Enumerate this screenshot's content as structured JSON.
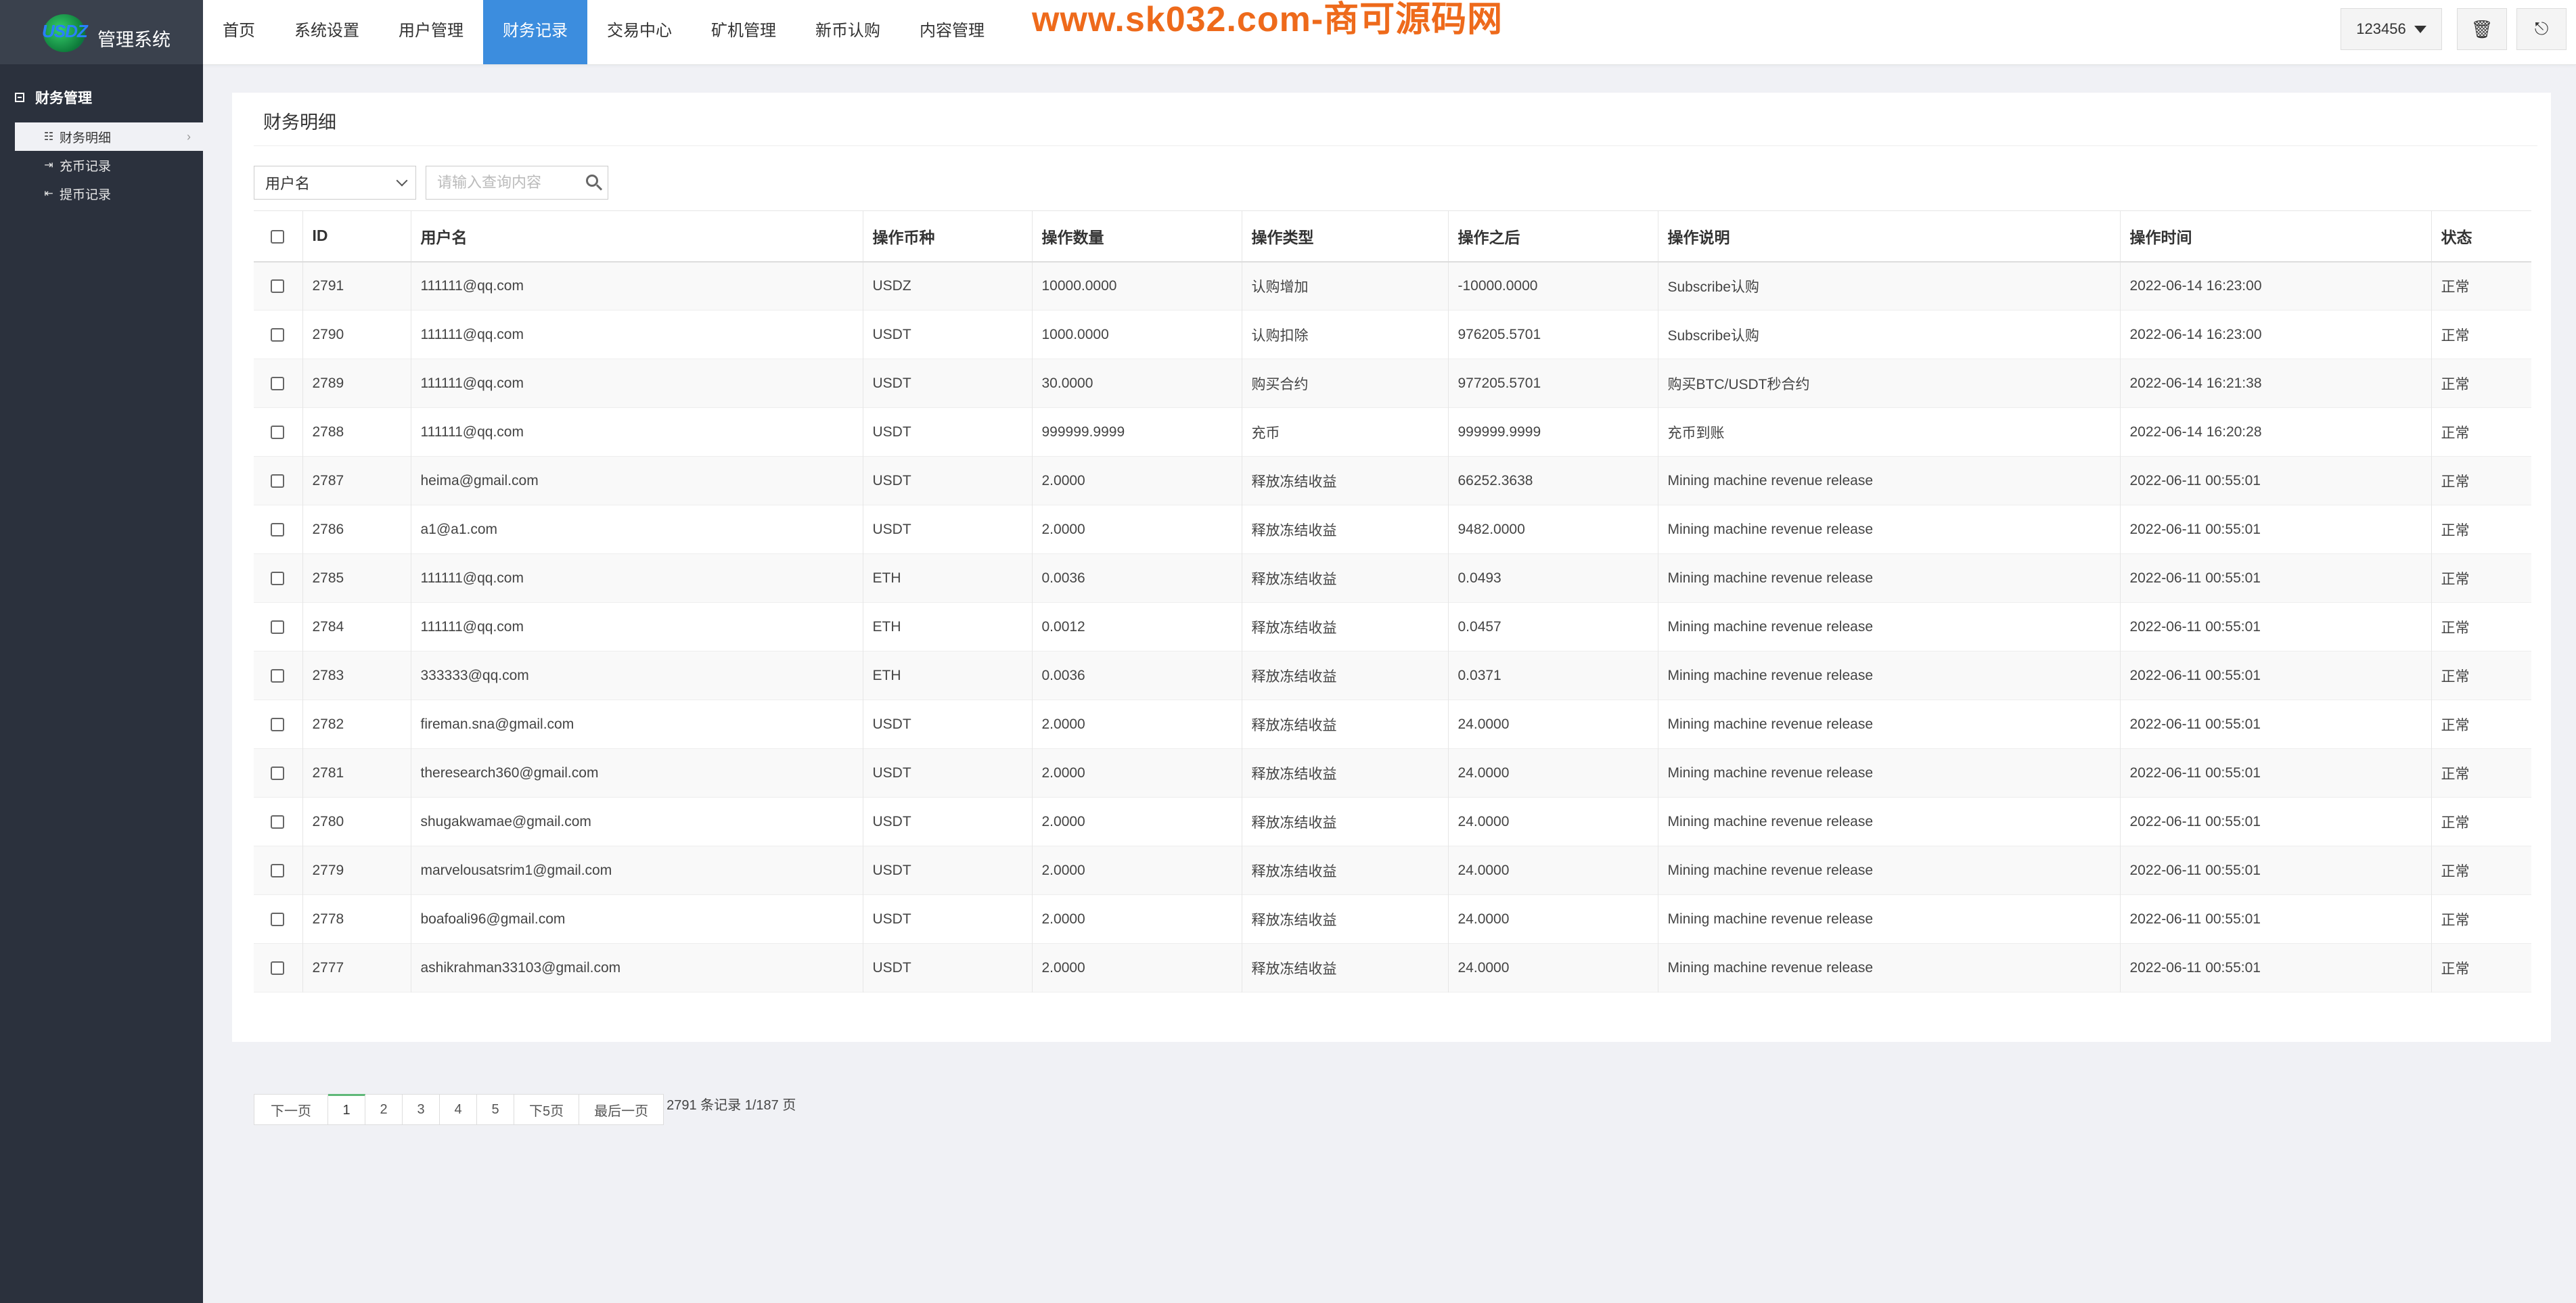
{
  "app": {
    "logo_mark": "USDZ",
    "title": "管理系统",
    "watermark": "www.sk032.com-商可源码网"
  },
  "nav": {
    "items": [
      "首页",
      "系统设置",
      "用户管理",
      "财务记录",
      "交易中心",
      "矿机管理",
      "新币认购",
      "内容管理"
    ],
    "active_index": 3
  },
  "header_right": {
    "user": "123456",
    "icons": [
      "trash-icon",
      "logout-icon"
    ]
  },
  "sidebar": {
    "group": "财务管理",
    "items": [
      {
        "label": "财务明细",
        "icon": "list-icon",
        "active": true
      },
      {
        "label": "充币记录",
        "icon": "sign-in-icon",
        "active": false
      },
      {
        "label": "提币记录",
        "icon": "sign-out-icon",
        "active": false
      }
    ]
  },
  "panel": {
    "title": "财务明细",
    "filter_select": "用户名",
    "search_placeholder": "请输入查询内容"
  },
  "table": {
    "columns": [
      "ID",
      "用户名",
      "操作币种",
      "操作数量",
      "操作类型",
      "操作之后",
      "操作说明",
      "操作时间",
      "状态"
    ],
    "rows": [
      [
        "2791",
        "111111@qq.com",
        "USDZ",
        "10000.0000",
        "认购增加",
        "-10000.0000",
        "Subscribe认购",
        "2022-06-14 16:23:00",
        "正常"
      ],
      [
        "2790",
        "111111@qq.com",
        "USDT",
        "1000.0000",
        "认购扣除",
        "976205.5701",
        "Subscribe认购",
        "2022-06-14 16:23:00",
        "正常"
      ],
      [
        "2789",
        "111111@qq.com",
        "USDT",
        "30.0000",
        "购买合约",
        "977205.5701",
        "购买BTC/USDT秒合约",
        "2022-06-14 16:21:38",
        "正常"
      ],
      [
        "2788",
        "111111@qq.com",
        "USDT",
        "999999.9999",
        "充币",
        "999999.9999",
        "充币到账",
        "2022-06-14 16:20:28",
        "正常"
      ],
      [
        "2787",
        "heima@gmail.com",
        "USDT",
        "2.0000",
        "释放冻结收益",
        "66252.3638",
        "Mining machine revenue release",
        "2022-06-11 00:55:01",
        "正常"
      ],
      [
        "2786",
        "a1@a1.com",
        "USDT",
        "2.0000",
        "释放冻结收益",
        "9482.0000",
        "Mining machine revenue release",
        "2022-06-11 00:55:01",
        "正常"
      ],
      [
        "2785",
        "111111@qq.com",
        "ETH",
        "0.0036",
        "释放冻结收益",
        "0.0493",
        "Mining machine revenue release",
        "2022-06-11 00:55:01",
        "正常"
      ],
      [
        "2784",
        "111111@qq.com",
        "ETH",
        "0.0012",
        "释放冻结收益",
        "0.0457",
        "Mining machine revenue release",
        "2022-06-11 00:55:01",
        "正常"
      ],
      [
        "2783",
        "333333@qq.com",
        "ETH",
        "0.0036",
        "释放冻结收益",
        "0.0371",
        "Mining machine revenue release",
        "2022-06-11 00:55:01",
        "正常"
      ],
      [
        "2782",
        "fireman.sna@gmail.com",
        "USDT",
        "2.0000",
        "释放冻结收益",
        "24.0000",
        "Mining machine revenue release",
        "2022-06-11 00:55:01",
        "正常"
      ],
      [
        "2781",
        "theresearch360@gmail.com",
        "USDT",
        "2.0000",
        "释放冻结收益",
        "24.0000",
        "Mining machine revenue release",
        "2022-06-11 00:55:01",
        "正常"
      ],
      [
        "2780",
        "shugakwamae@gmail.com",
        "USDT",
        "2.0000",
        "释放冻结收益",
        "24.0000",
        "Mining machine revenue release",
        "2022-06-11 00:55:01",
        "正常"
      ],
      [
        "2779",
        "marvelousatsrim1@gmail.com",
        "USDT",
        "2.0000",
        "释放冻结收益",
        "24.0000",
        "Mining machine revenue release",
        "2022-06-11 00:55:01",
        "正常"
      ],
      [
        "2778",
        "boafoali96@gmail.com",
        "USDT",
        "2.0000",
        "释放冻结收益",
        "24.0000",
        "Mining machine revenue release",
        "2022-06-11 00:55:01",
        "正常"
      ],
      [
        "2777",
        "ashikrahman33103@gmail.com",
        "USDT",
        "2.0000",
        "释放冻结收益",
        "24.0000",
        "Mining machine revenue release",
        "2022-06-11 00:55:01",
        "正常"
      ]
    ]
  },
  "pagination": {
    "prev": "下一页",
    "pages": [
      "1",
      "2",
      "3",
      "4",
      "5"
    ],
    "current": "1",
    "next5": "下5页",
    "last": "最后一页",
    "info": "2791 条记录 1/187 页"
  }
}
